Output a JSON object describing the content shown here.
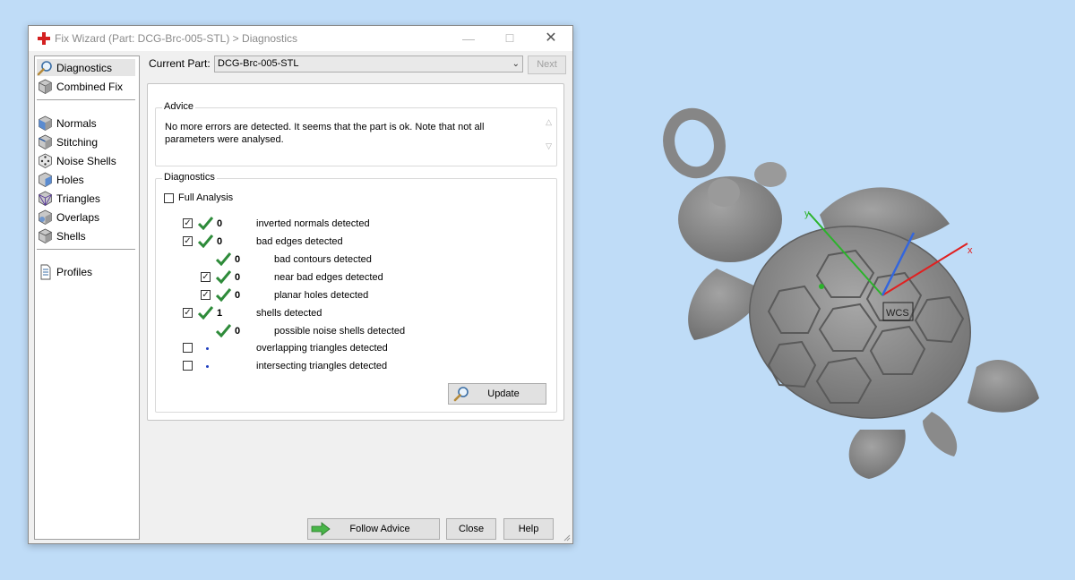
{
  "window": {
    "title": "Fix Wizard (Part: DCG-Brc-005-STL) > Diagnostics",
    "minimize_glyph": "—",
    "maximize_glyph": "☐",
    "close_glyph": "✕"
  },
  "nav": {
    "items": [
      {
        "label": "Diagnostics",
        "icon": "magnifier-icon",
        "selected": true
      },
      {
        "label": "Combined Fix",
        "icon": "cube-icon"
      },
      {
        "label": "Normals",
        "icon": "cube-icon"
      },
      {
        "label": "Stitching",
        "icon": "cube-icon"
      },
      {
        "label": "Noise Shells",
        "icon": "dice-icon"
      },
      {
        "label": "Holes",
        "icon": "cube-icon"
      },
      {
        "label": "Triangles",
        "icon": "cube-icon"
      },
      {
        "label": "Overlaps",
        "icon": "cube-icon"
      },
      {
        "label": "Shells",
        "icon": "cube-icon"
      },
      {
        "label": "Profiles",
        "icon": "document-icon"
      }
    ]
  },
  "current_part": {
    "label": "Current Part:",
    "value": "DCG-Brc-005-STL",
    "next_label": "Next"
  },
  "advice": {
    "title": "Advice",
    "text": "No more errors are detected. It seems that the part is ok. Note that not all parameters were analysed."
  },
  "diagnostics": {
    "title": "Diagnostics",
    "full_analysis_label": "Full Analysis",
    "rows": [
      {
        "checked": true,
        "status": "ok",
        "count": "0",
        "label": "inverted normals detected"
      },
      {
        "checked": true,
        "status": "ok",
        "count": "0",
        "label": "bad edges detected"
      },
      {
        "status": "ok",
        "count": "0",
        "label": "bad contours detected"
      },
      {
        "checked": true,
        "status": "ok",
        "count": "0",
        "label": "near bad edges detected"
      },
      {
        "checked": true,
        "status": "ok",
        "count": "0",
        "label": "planar holes detected"
      },
      {
        "checked": true,
        "status": "ok",
        "count": "1",
        "label": "shells detected"
      },
      {
        "status": "ok",
        "count": "0",
        "label": "possible noise shells detected"
      },
      {
        "checked": false,
        "status": "not-analysed",
        "label": "overlapping triangles detected"
      },
      {
        "checked": false,
        "status": "not-analysed",
        "label": "intersecting triangles detected"
      }
    ],
    "update_label": "Update"
  },
  "footer": {
    "follow_advice_label": "Follow Advice",
    "close_label": "Close",
    "help_label": "Help"
  },
  "viewport": {
    "axis_x_label": "x",
    "axis_y_label": "y",
    "wcs_label": "WCS",
    "axis_colors": {
      "x": "#e02020",
      "y": "#2bb32b",
      "z": "#3366dd"
    }
  },
  "colors": {
    "background": "#bfdcf7",
    "check_green": "#2e8b3a",
    "model_gray": "#8c8c8c"
  }
}
